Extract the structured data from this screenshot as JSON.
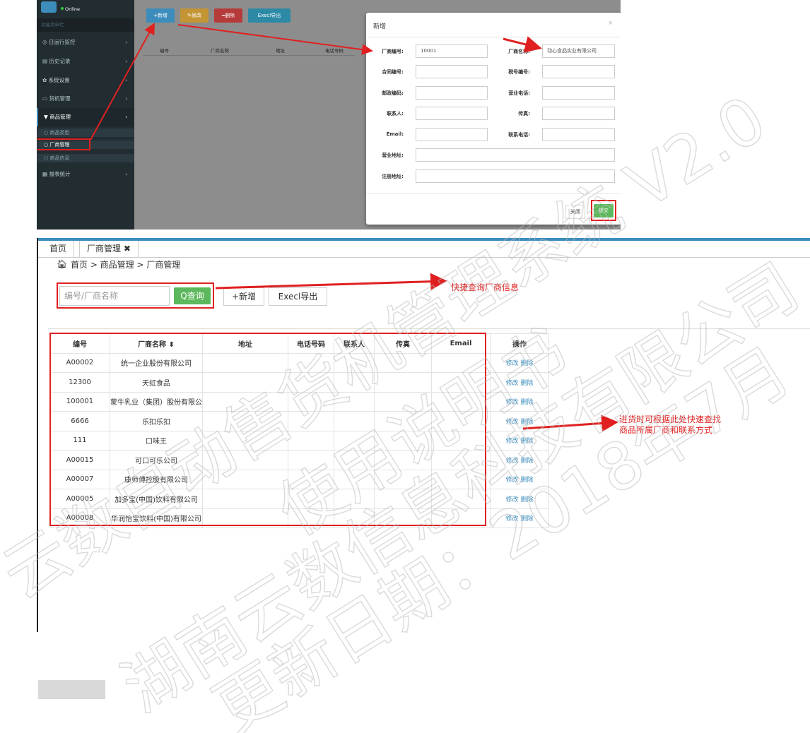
{
  "shot1": {
    "status": "Online",
    "menu_header": "功能菜单栏",
    "nav": [
      {
        "label": "◎ 日运行监控",
        "chev": "‹"
      },
      {
        "label": "▤ 历史记录",
        "chev": "‹"
      },
      {
        "label": "✿ 系统设置",
        "chev": "‹"
      },
      {
        "label": "▭ 货机管理",
        "chev": "‹"
      },
      {
        "label": "▼ 商品管理",
        "chev": "‹"
      }
    ],
    "subnav": [
      "○ 商品类型",
      "○ 厂商管理",
      "○ 商品信息"
    ],
    "nav_report": {
      "label": "▦ 报表统计",
      "chev": "‹"
    },
    "toolbar": {
      "add": "+新增",
      "edit": "✎修改",
      "delete": "━删除",
      "export": "Execl导出"
    },
    "table_headers": [
      "编号",
      "厂商名称",
      "地址",
      "电话号码"
    ],
    "modal": {
      "title": "新增",
      "close": "×",
      "fields": {
        "vendor_no_label": "厂商编号:",
        "vendor_no_value": "10001",
        "vendor_name_label": "厂商名称:",
        "vendor_name_value": "动心食品实业有限公司",
        "contract_label": "合同编号:",
        "tax_label": "税号编号:",
        "postal_label": "邮政编码:",
        "biz_phone_label": "营业电话:",
        "contact_label": "联系人:",
        "fax_label": "传真:",
        "email_label": "Email:",
        "contact_phone_label": "联系电话:",
        "biz_addr_label": "营业地址:",
        "reg_addr_label": "注册地址:"
      },
      "close_button": "关闭",
      "submit_button": "提交"
    }
  },
  "shot2": {
    "tabs": [
      "首页",
      "厂商管理 ✖"
    ],
    "breadcrumb": "首页  > 商品管理 > 厂商管理",
    "search_placeholder": "编号/厂商名称",
    "search_button": "Q查询",
    "add_button": "+新增",
    "export_button": "Execl导出",
    "note_search": "快捷查询厂商信息",
    "note_table": "进货时可根据此处快速查找\n商品所属厂商和联系方式",
    "columns": [
      "编号",
      "厂商名称 ⬍",
      "地址",
      "电话号码",
      "联系人",
      "传真",
      "Email",
      "操作"
    ],
    "rows": [
      [
        "A00002",
        "统一企业股份有限公司"
      ],
      [
        "12300",
        "天虹食品"
      ],
      [
        "100001",
        "蒙牛乳业（集团）股份有限公"
      ],
      [
        "6666",
        "乐扣乐扣"
      ],
      [
        "111",
        "口味王"
      ],
      [
        "A00015",
        "可口可乐公司"
      ],
      [
        "A00007",
        "康师傅控股有限公司"
      ],
      [
        "A00005",
        "加多宝(中国)饮料有限公司"
      ],
      [
        "A00008",
        "华润怡宝饮料(中国)有限公司"
      ]
    ],
    "row_actions": [
      "修改",
      "删除"
    ]
  },
  "watermark": {
    "lines": [
      "云数自动售货机管理系统 V2.0",
      "使用说明书",
      "湖南云数信息科技有限公司",
      "更新日期：2018年7月"
    ]
  },
  "colors": {
    "accent_red": "#e02020",
    "green": "#5cb85c",
    "blue": "#3c8dbc",
    "sidebar": "#222d32"
  }
}
